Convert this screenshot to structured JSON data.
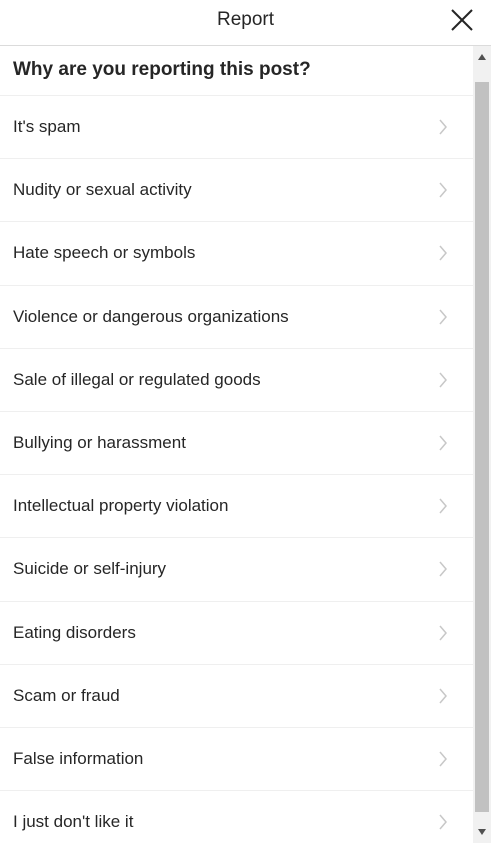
{
  "header": {
    "title": "Report",
    "close_icon": "close-icon"
  },
  "question": "Why are you reporting this post?",
  "items": [
    {
      "label": "It's spam"
    },
    {
      "label": "Nudity or sexual activity"
    },
    {
      "label": "Hate speech or symbols"
    },
    {
      "label": "Violence or dangerous organizations"
    },
    {
      "label": "Sale of illegal or regulated goods"
    },
    {
      "label": "Bullying or harassment"
    },
    {
      "label": "Intellectual property violation"
    },
    {
      "label": "Suicide or self-injury"
    },
    {
      "label": "Eating disorders"
    },
    {
      "label": "Scam or fraud"
    },
    {
      "label": "False information"
    },
    {
      "label": "I just don't like it"
    }
  ],
  "colors": {
    "text": "#262626",
    "divider": "#efefef",
    "chevron": "#c7c7c7",
    "scrollbar_track": "#f1f1f1",
    "scrollbar_thumb": "#c1c1c1"
  }
}
